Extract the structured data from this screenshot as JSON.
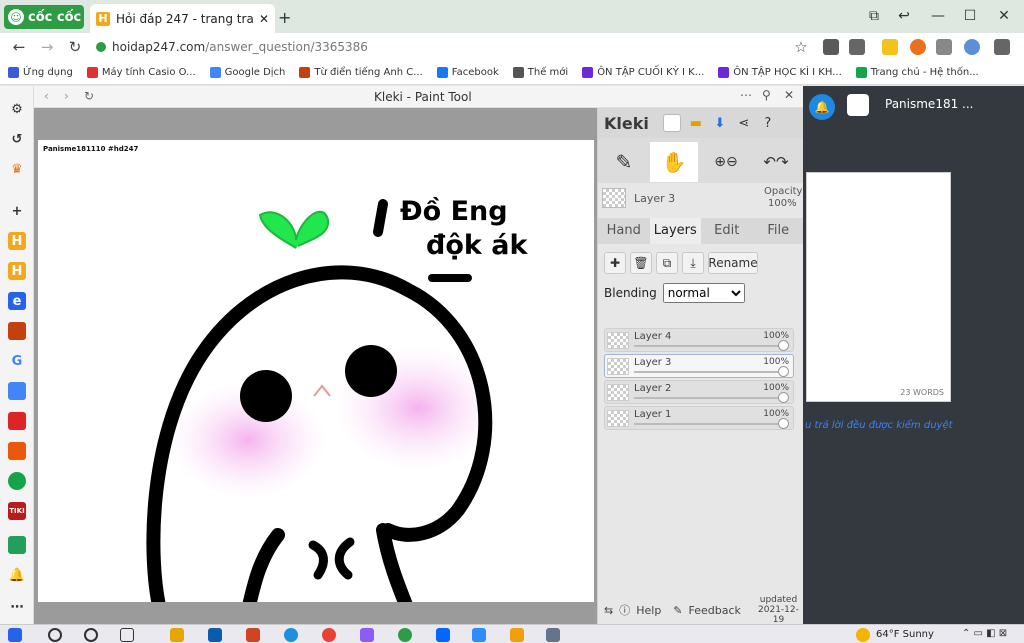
{
  "browser": {
    "brand": "cốc cốc",
    "tab_title": "Hỏi đáp 247 - trang tra lời",
    "url_host": "hoidap247.com",
    "url_path": "/answer_question/3365386",
    "bookmarks": [
      {
        "label": "Ứng dụng",
        "color": "#3b5bdb"
      },
      {
        "label": "Máy tính Casio O...",
        "color": "#e03131"
      },
      {
        "label": "Google Dịch",
        "color": "#4285f4"
      },
      {
        "label": "Từ điển tiếng Anh C...",
        "color": "#c2410c"
      },
      {
        "label": "Facebook",
        "color": "#1877f2"
      },
      {
        "label": "Thế mới",
        "color": "#555555"
      },
      {
        "label": "ÔN TẬP CUỐI KỲ I K...",
        "color": "#6d28d9"
      },
      {
        "label": "ÔN TẬP HỌC KÌ I KH...",
        "color": "#6d28d9"
      },
      {
        "label": "Trang chủ - Hệ thốn...",
        "color": "#16a34a"
      }
    ]
  },
  "kleki": {
    "window_title": "Kleki - Paint Tool",
    "watermark": "Panisme181110 #hd247",
    "drawing_text_line1": "Đồ Eng",
    "drawing_text_line2": "độk ák",
    "brand": "Kleki",
    "current_layer": "Layer 3",
    "opacity_label": "Opacity",
    "opacity_value": "100%",
    "tabs": [
      "Hand",
      "Layers",
      "Edit",
      "File"
    ],
    "active_tab": "Layers",
    "rename_label": "Rename",
    "blending_label": "Blending",
    "blending_value": "normal",
    "layers": [
      {
        "name": "Layer 4",
        "opacity": "100%",
        "level": 1.0
      },
      {
        "name": "Layer 3",
        "opacity": "100%",
        "level": 1.0,
        "selected": true
      },
      {
        "name": "Layer 2",
        "opacity": "100%",
        "level": 1.0
      },
      {
        "name": "Layer 1",
        "opacity": "100%",
        "level": 1.0
      }
    ],
    "help_label": "Help",
    "feedback_label": "Feedback",
    "updated_label": "updated",
    "updated_date": "2021-12-19"
  },
  "page": {
    "username": "Panisme181 ...",
    "word_count": "23 WORDS",
    "note_text": "u trả lời đều được kiểm duyệt"
  },
  "taskbar": {
    "weather": "64°F  Sunny"
  }
}
